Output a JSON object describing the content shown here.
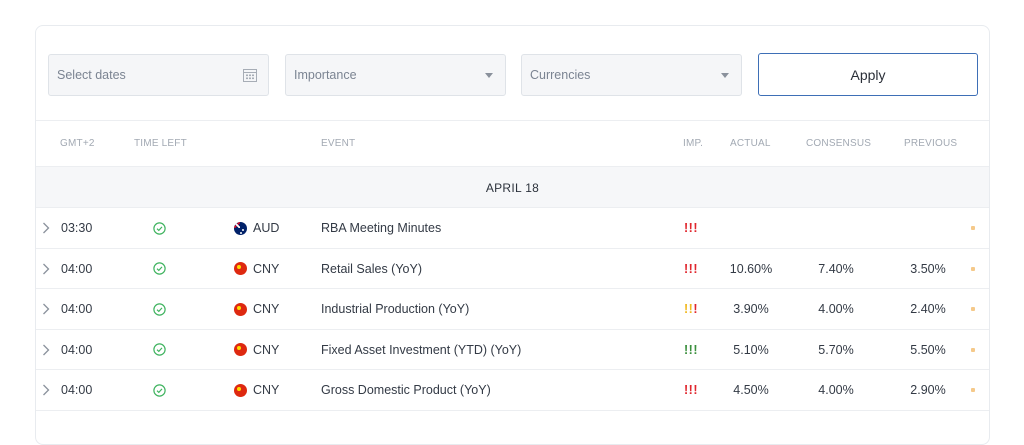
{
  "filters": {
    "dates_placeholder": "Select dates",
    "importance_placeholder": "Importance",
    "currencies_placeholder": "Currencies",
    "apply_label": "Apply"
  },
  "table": {
    "headers": {
      "timezone": "GMT+2",
      "time_left": "TIME LEFT",
      "event": "EVENT",
      "importance": "IMP.",
      "actual": "ACTUAL",
      "consensus": "CONSENSUS",
      "previous": "PREVIOUS"
    },
    "date_label": "APRIL 18",
    "rows": [
      {
        "time": "03:30",
        "currency": "AUD",
        "flag": "au",
        "event": "RBA Meeting Minutes",
        "importance": [
          "high",
          "high",
          "high"
        ],
        "actual": "",
        "consensus": "",
        "previous": ""
      },
      {
        "time": "04:00",
        "currency": "CNY",
        "flag": "cn",
        "event": "Retail Sales (YoY)",
        "importance": [
          "high",
          "high",
          "high"
        ],
        "actual": "10.60%",
        "consensus": "7.40%",
        "previous": "3.50%"
      },
      {
        "time": "04:00",
        "currency": "CNY",
        "flag": "cn",
        "event": "Industrial Production (YoY)",
        "importance": [
          "medium",
          "medium",
          "high"
        ],
        "actual": "3.90%",
        "consensus": "4.00%",
        "previous": "2.40%"
      },
      {
        "time": "04:00",
        "currency": "CNY",
        "flag": "cn",
        "event": "Fixed Asset Investment (YTD) (YoY)",
        "importance": [
          "low",
          "low",
          "low"
        ],
        "actual": "5.10%",
        "consensus": "5.70%",
        "previous": "5.50%"
      },
      {
        "time": "04:00",
        "currency": "CNY",
        "flag": "cn",
        "event": "Gross Domestic Product (YoY)",
        "importance": [
          "high",
          "high",
          "high"
        ],
        "actual": "4.50%",
        "consensus": "4.00%",
        "previous": "2.90%"
      }
    ]
  },
  "icons": {
    "time_left": "check-circle-icon",
    "expand": "chevron-right-icon",
    "dates": "calendar-icon",
    "dropdown": "caret-down-icon"
  },
  "colors": {
    "importance_high": "#e0262d",
    "importance_medium": "#f1b81f",
    "importance_low": "#3a8f3d",
    "check": "#3fb35f",
    "accent": "#3e6fb6",
    "row_dot": "#f5c98a"
  }
}
